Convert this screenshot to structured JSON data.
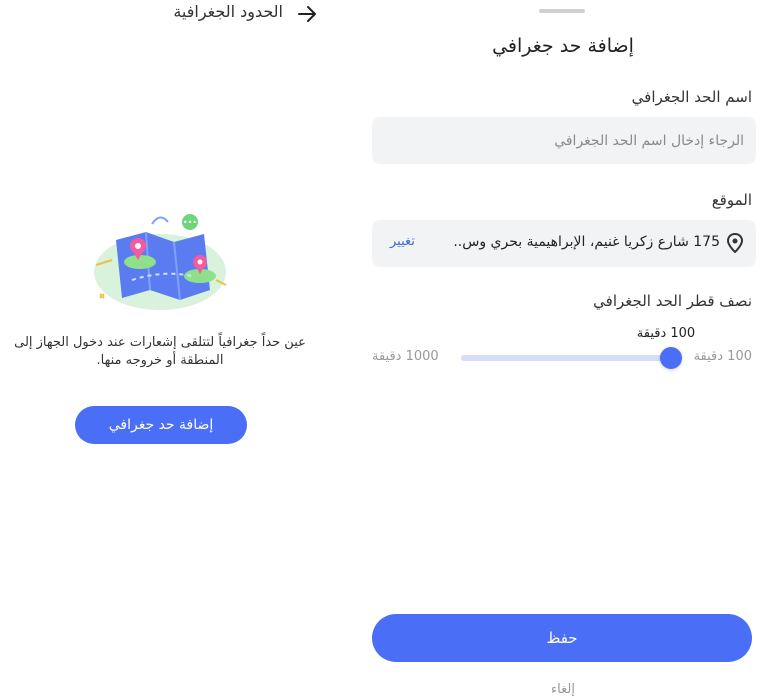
{
  "left": {
    "header_title": "الحدود الجغرافية",
    "empty_description": "عين حداً جغرافياً لتتلقى إشعارات عند دخول الجهاز إلى المنطقة أو خروجه منها.",
    "add_button_label": "إضافة حد جغرافي"
  },
  "sheet": {
    "title": "إضافة حد جغرافي",
    "name_label": "اسم الحد الجغرافي",
    "name_placeholder": "الرجاء إدخال اسم الحد الجغرافي",
    "name_value": "",
    "location_label": "الموقع",
    "location_text": "175 شارع زكريا غنيم، الإبراهيمية بحري وس..",
    "location_change": "تغيير",
    "radius_label": "نصف قطر الحد الجغرافي",
    "radius_current": "100 دقيقة",
    "radius_min_label": "100 دقيقة",
    "radius_max_label": "1000 دقيقة",
    "save_label": "حفظ",
    "cancel_label": "إلغاء"
  },
  "colors": {
    "accent": "#4a6ef5",
    "input_bg": "#f2f3f5",
    "link": "#3a6ad6"
  }
}
